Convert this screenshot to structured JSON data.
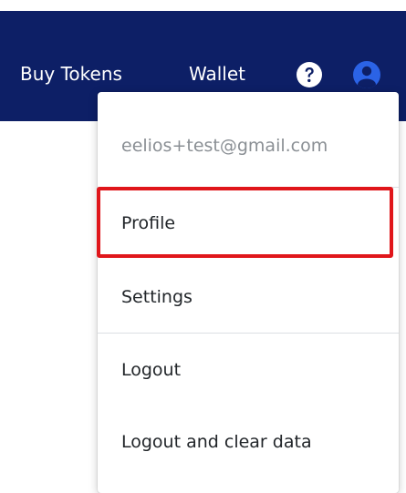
{
  "navbar": {
    "buy_tokens": "Buy Tokens",
    "wallet": "Wallet",
    "help_icon": "question-circle-icon",
    "user_icon": "user-circle-icon",
    "background_color": "#0d1f66",
    "accent_color": "#2b63e6"
  },
  "user_menu": {
    "email": "eelios+test@gmail.com",
    "items": [
      {
        "label": "Profile",
        "highlighted": true
      },
      {
        "label": "Settings"
      },
      {
        "label": "Logout"
      },
      {
        "label": "Logout and clear data"
      }
    ],
    "highlight_color": "#e0161b"
  }
}
